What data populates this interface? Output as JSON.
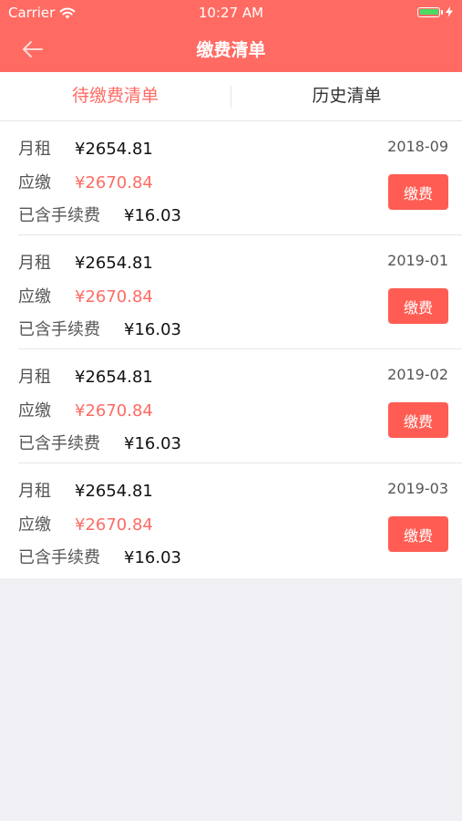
{
  "status_bar": {
    "carrier": "Carrier",
    "time": "10:27 AM"
  },
  "nav": {
    "title": "缴费清单"
  },
  "tabs": [
    {
      "label": "待缴费清单",
      "active": true
    },
    {
      "label": "历史清单",
      "active": false
    }
  ],
  "bills": [
    {
      "rent_label": "月租",
      "rent": "¥2654.81",
      "due_label": "应缴",
      "due": "¥2670.84",
      "fee_label": "已含手续费",
      "fee": "¥16.03",
      "period": "2018-09",
      "pay_label": "缴费"
    },
    {
      "rent_label": "月租",
      "rent": "¥2654.81",
      "due_label": "应缴",
      "due": "¥2670.84",
      "fee_label": "已含手续费",
      "fee": "¥16.03",
      "period": "2019-01",
      "pay_label": "缴费"
    },
    {
      "rent_label": "月租",
      "rent": "¥2654.81",
      "due_label": "应缴",
      "due": "¥2670.84",
      "fee_label": "已含手续费",
      "fee": "¥16.03",
      "period": "2019-02",
      "pay_label": "缴费"
    },
    {
      "rent_label": "月租",
      "rent": "¥2654.81",
      "due_label": "应缴",
      "due": "¥2670.84",
      "fee_label": "已含手续费",
      "fee": "¥16.03",
      "period": "2019-03",
      "pay_label": "缴费"
    }
  ],
  "colors": {
    "brand": "#ff6b63",
    "button": "#ff5d53",
    "background": "#efeff4",
    "battery": "#4cd964"
  },
  "icons": {
    "back": "back-arrow-icon",
    "wifi": "wifi-icon",
    "battery": "battery-icon",
    "charging": "charging-bolt-icon"
  }
}
